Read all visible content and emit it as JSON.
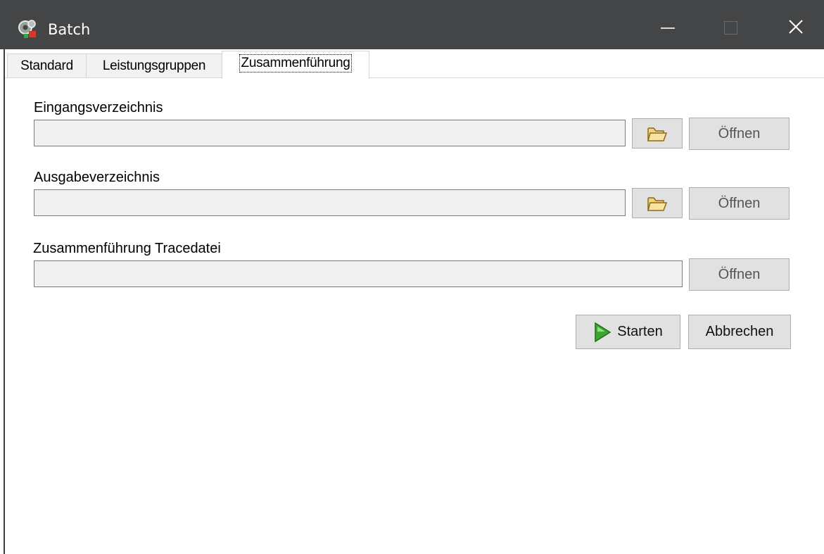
{
  "window": {
    "title": "Batch",
    "app_icon": "gear-icon",
    "controls": {
      "minimize": "minimize-icon",
      "maximize": "maximize-icon",
      "close": "close-icon"
    }
  },
  "tabs": [
    {
      "label": "Standard",
      "selected": false
    },
    {
      "label": "Leistungsgruppen",
      "selected": false
    },
    {
      "label": "Zusammenführung",
      "selected": true
    }
  ],
  "form": {
    "input_dir": {
      "label": "Eingangsverzeichnis",
      "value": "",
      "browse_icon": "folder-icon",
      "open_label": "Öffnen"
    },
    "output_dir": {
      "label": "Ausgabeverzeichnis",
      "value": "",
      "browse_icon": "folder-icon",
      "open_label": "Öffnen"
    },
    "trace_file": {
      "label": "Zusammenführung Tracedatei",
      "value": "",
      "open_label": "Öffnen"
    }
  },
  "actions": {
    "start_label": "Starten",
    "start_icon": "play-icon",
    "cancel_label": "Abbrechen"
  },
  "colors": {
    "titlebar": "#444546",
    "button_face": "#e1e1e1",
    "field_background": "#f0f0f0",
    "start_icon": "#3aa82f"
  }
}
